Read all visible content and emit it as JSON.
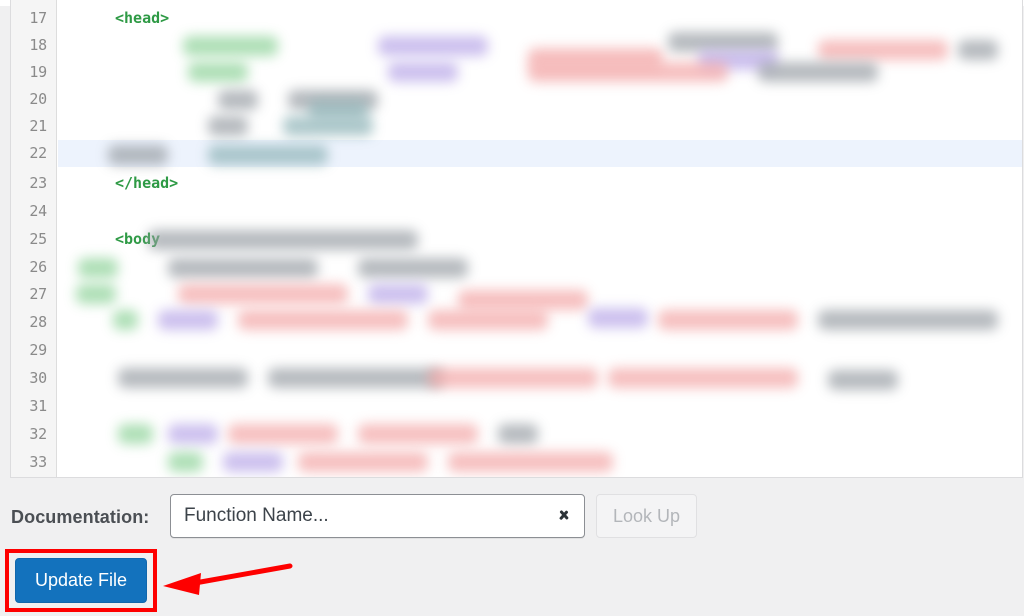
{
  "app": {
    "context": "wordpress-theme-file-editor"
  },
  "editor": {
    "first_line": 17,
    "last_line": 33,
    "active_line": 22,
    "lines": [
      {
        "number": "17",
        "text": "<head>",
        "type": "code",
        "active": false
      },
      {
        "number": "18",
        "text": "",
        "type": "redacted",
        "active": false
      },
      {
        "number": "19",
        "text": "",
        "type": "redacted",
        "active": false
      },
      {
        "number": "20",
        "text": "",
        "type": "redacted",
        "active": false
      },
      {
        "number": "21",
        "text": "",
        "type": "redacted",
        "active": false
      },
      {
        "number": "22",
        "text": "",
        "type": "redacted",
        "active": true
      },
      {
        "number": "23",
        "text": "</head>",
        "type": "code",
        "active": false
      },
      {
        "number": "24",
        "text": "",
        "type": "blank",
        "active": false
      },
      {
        "number": "25",
        "text": "<body",
        "type": "code",
        "active": false
      },
      {
        "number": "26",
        "text": "",
        "type": "redacted",
        "active": false
      },
      {
        "number": "27",
        "text": "",
        "type": "redacted",
        "active": false
      },
      {
        "number": "28",
        "text": "",
        "type": "redacted",
        "active": false
      },
      {
        "number": "29",
        "text": "",
        "type": "redacted",
        "active": false
      },
      {
        "number": "30",
        "text": "",
        "type": "redacted",
        "active": false
      },
      {
        "number": "31",
        "text": "",
        "type": "blank",
        "active": false
      },
      {
        "number": "32",
        "text": "",
        "type": "redacted",
        "active": false
      },
      {
        "number": "33",
        "text": "",
        "type": "redacted",
        "active": false
      }
    ],
    "syntax_colors": {
      "tag": "#2e9a45",
      "active_line_background": "#edf3fd",
      "gutter_background": "#f5f5f5",
      "line_number": "#8a8a8a"
    }
  },
  "documentation": {
    "label": "Documentation:",
    "select_value": "Function Name...",
    "select_icon": "chevron-down-icon",
    "lookup_label": "Look Up",
    "lookup_disabled": true
  },
  "actions": {
    "update_label": "Update File",
    "update_color": "#1372bd"
  },
  "annotation": {
    "highlight_color": "#fe0000",
    "arrow_direction": "left",
    "target": "update-file-button"
  }
}
